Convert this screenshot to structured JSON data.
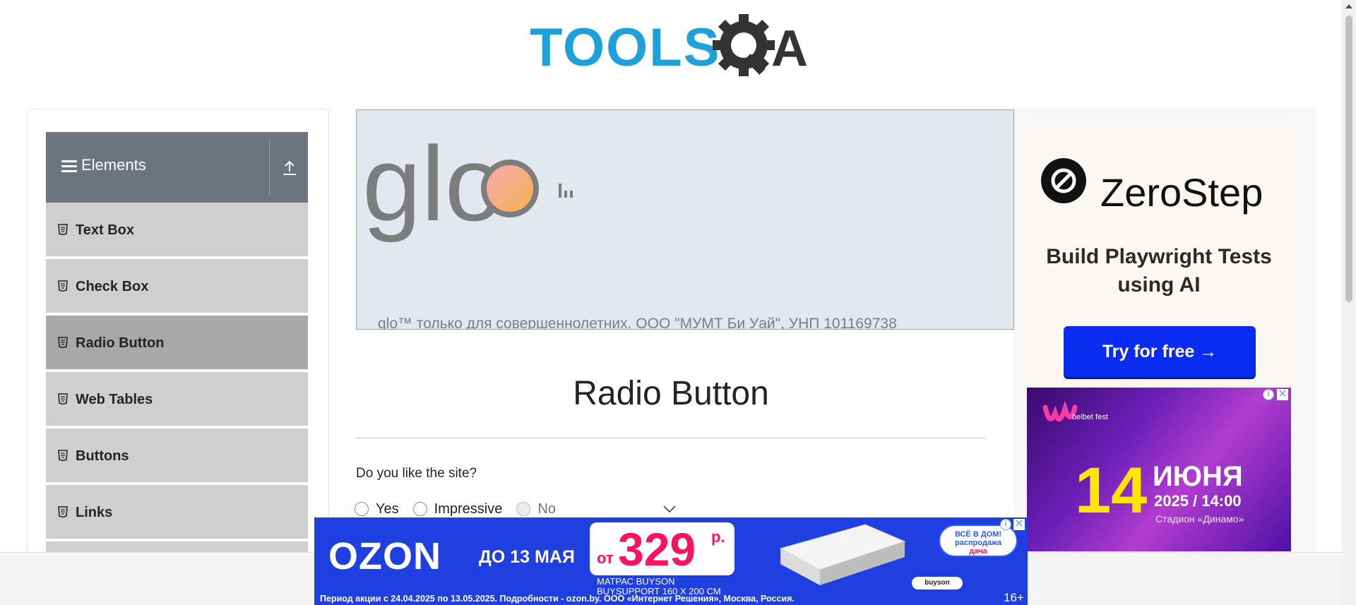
{
  "header": {
    "logo_text": "TOOLSQA"
  },
  "sidebar": {
    "group_title": "Elements",
    "items": [
      {
        "label": "Text Box",
        "active": false
      },
      {
        "label": "Check Box",
        "active": false
      },
      {
        "label": "Radio Button",
        "active": true
      },
      {
        "label": "Web Tables",
        "active": false
      },
      {
        "label": "Buttons",
        "active": false
      },
      {
        "label": "Links",
        "active": false
      }
    ]
  },
  "glo_ad": {
    "brand": "glo",
    "disclaimer": "glo™ только для совершеннолетних. ООО \"МУМТ Би Уай\", УНП 101169738"
  },
  "zerostep_ad": {
    "brand": "ZeroStep",
    "tagline": "Build Playwright Tests using AI",
    "cta_label": "Try for free →"
  },
  "belbet_ad": {
    "brand": "belbet fest",
    "day": "14",
    "month": "ИЮНЯ",
    "time": "2025 / 14:00",
    "venue": "Стадион «Динамо»"
  },
  "main": {
    "title": "Radio Button",
    "question": "Do you like the site?",
    "options": [
      {
        "label": "Yes",
        "disabled": false
      },
      {
        "label": "Impressive",
        "disabled": false
      },
      {
        "label": "No",
        "disabled": true
      }
    ]
  },
  "ozon_ad": {
    "brand": "OZON",
    "until": "ДО 13 МАЯ",
    "price_from": "от",
    "price": "329",
    "currency": "р.",
    "product_line1": "МАТРАС BUYSON",
    "product_line2": "BUYSUPPORT 160 X 200 СМ",
    "promo_line1": "ВСЁ В ДОМ!",
    "promo_line2": "распродажа",
    "promo_line3": "дача",
    "buyson_label": "buyson",
    "disclaimer": "Период акции с 24.04.2025 по 13.05.2025. Подробности - ozon.by. ООО «Интернет Решения», Москва, Россия.",
    "age": "16+"
  },
  "colors": {
    "sidebar_header": "#6c757d",
    "sidebar_item": "#cfcfcf",
    "sidebar_item_active": "#a8a8a8",
    "logo_blue": "#1ea0d8",
    "logo_dark": "#333333",
    "zerostep_cta": "#0a2cf0",
    "ozon_blue": "#1f3fe0",
    "ozon_price": "#ff1361"
  }
}
